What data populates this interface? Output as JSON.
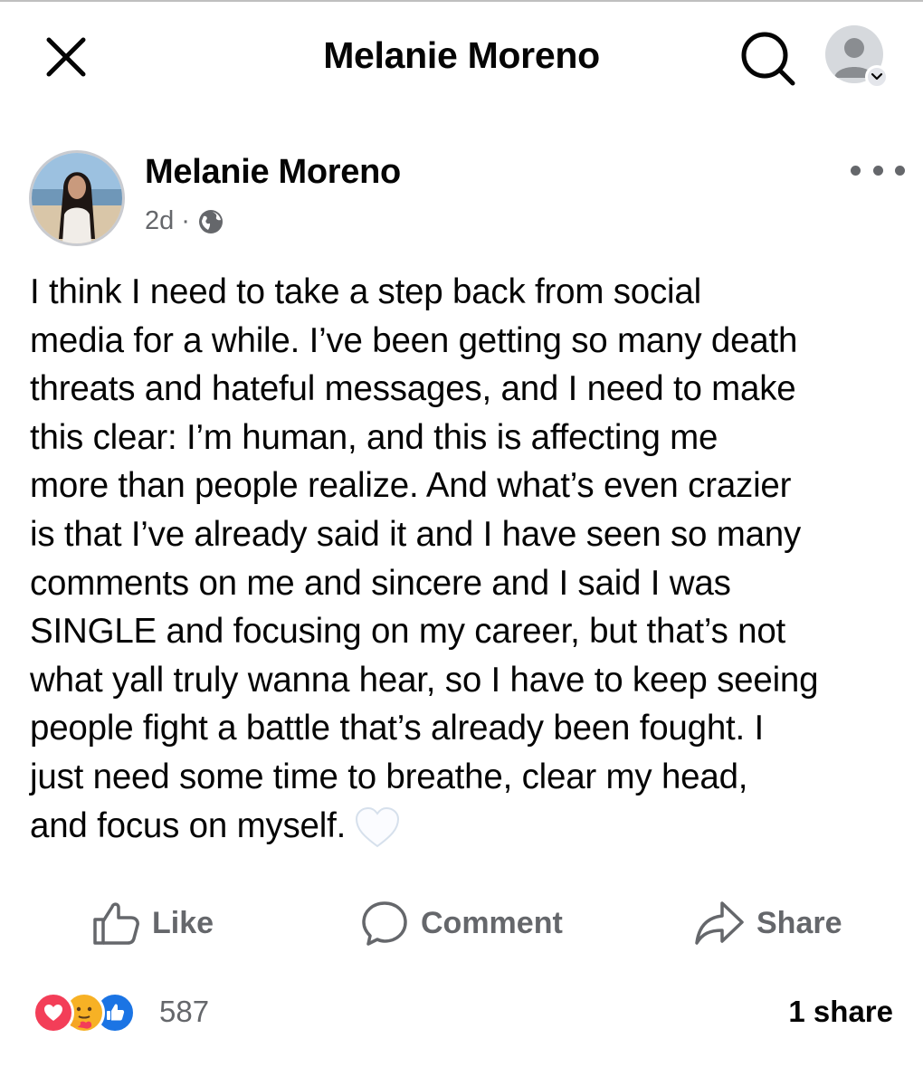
{
  "header": {
    "title": "Melanie Moreno",
    "close_icon": "close-icon",
    "search_icon": "search-icon",
    "profile_icon": "profile-avatar-icon"
  },
  "post": {
    "author": "Melanie Moreno",
    "time": "2d",
    "separator": "·",
    "privacy_icon": "globe-icon",
    "body_lines": [
      "I think I need to take a step back from social",
      "media for a while. I’ve been getting so many death",
      "threats and hateful messages, and I need to make",
      "this clear: I’m human, and this is affecting me",
      "more than people realize. And what’s even crazier",
      "is that I’ve already said it and I have seen so many",
      "comments on me and sincere and I said I was",
      "SINGLE and focusing on my career, but that’s not",
      "what yall truly wanna hear, so I have to keep seeing",
      "people fight a battle that’s already been fought. I",
      "just need some time to breathe, clear my head,",
      "and focus on myself."
    ],
    "emoji": "white-heart-icon"
  },
  "actions": {
    "like": "Like",
    "comment": "Comment",
    "share": "Share"
  },
  "stats": {
    "reaction_count": "587",
    "share_count": "1 share",
    "reaction_icons": [
      "love-reaction-icon",
      "care-reaction-icon",
      "like-reaction-icon"
    ]
  },
  "colors": {
    "text": "#050505",
    "secondary": "#65676b",
    "love": "#f33e58",
    "care": "#f7b125",
    "like": "#1b74e4"
  }
}
